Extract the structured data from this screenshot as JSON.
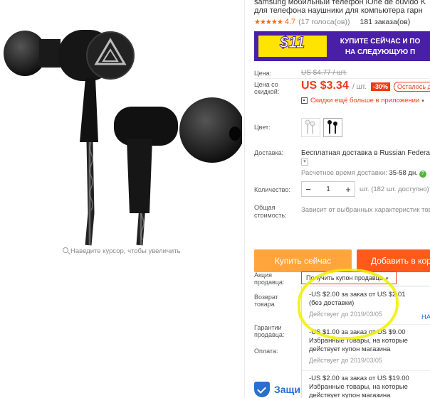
{
  "product": {
    "title_line1": "samsung мобильный телефон iOne de ouvido K",
    "title_line2": "для телефона наушники для компьютера гарн",
    "rating": "4.7",
    "votes": "(17 голоса(ов))",
    "orders": "181 заказа(ов)",
    "stars": "★★★★★"
  },
  "gallery": {
    "zoom_hint": "Наведите курсор, чтобы увеличить"
  },
  "banner": {
    "badge": "$11",
    "line1": "КУПИТЕ СЕЙЧАС И ПО",
    "line2": "НА СЛЕДУЮЩУЮ П"
  },
  "price": {
    "label_price": "Цена:",
    "old_price": "US $4.77 / шт.",
    "label_discount_price_1": "Цена со",
    "label_discount_price_2": "скидкой:",
    "current": "US $3.34",
    "per": "/ шт.",
    "discount": "-30%",
    "remaining": "Осталось д",
    "app_discount": "Скидки ещё больше в приложении",
    "app_caret": "▾"
  },
  "options": {
    "color_label": "Цвет:",
    "shipping_label": "Доставка:",
    "shipping_value": "Бесплатная доставка в Russian Federatio",
    "shipping_caret": "▾",
    "eta_label": "Расчетное время доставки:",
    "eta_value": "35-58 дн.",
    "info": "?",
    "qty_label": "Количество:",
    "qty_minus": "−",
    "qty_value": "1",
    "qty_plus": "+",
    "qty_note": "шт. (182 шт. доступно)",
    "total_label_1": "Общая",
    "total_label_2": "стоимость:",
    "total_note": "Зависит от выбранных характеристик товар"
  },
  "actions": {
    "buy_now": "Купить сейчас",
    "add_to_cart": "Добавить в корзи"
  },
  "promo": {
    "promo_label_1": "Акция",
    "promo_label_2": "продавца:",
    "return_label_1": "Возврат",
    "return_label_2": "товара",
    "guarantee_label_1": "Гарантии",
    "guarantee_label_2": "продавца:",
    "payment_label": "Оплата:",
    "coupon_select": "Получить купон продавца",
    "coupon_caret": "▾",
    "coupons": [
      {
        "line1": "-US $2.00 за заказ от US $2.01",
        "line2": "(без доставки)",
        "valid": "Действует до 2019/03/05",
        "take": "НАЙТ"
      },
      {
        "line1": "-US $1.00 за заказ от US $9.00",
        "line2": "Избранные товары, на которые",
        "line3": "действует купон магазина",
        "valid": "Действует до 2019/03/05"
      },
      {
        "line1": "-US $2.00 за заказ от US $19.00",
        "line2": "Избранные товары, на которые",
        "line3": "действует купон магазина"
      }
    ]
  },
  "protection": {
    "label": "Защи"
  }
}
